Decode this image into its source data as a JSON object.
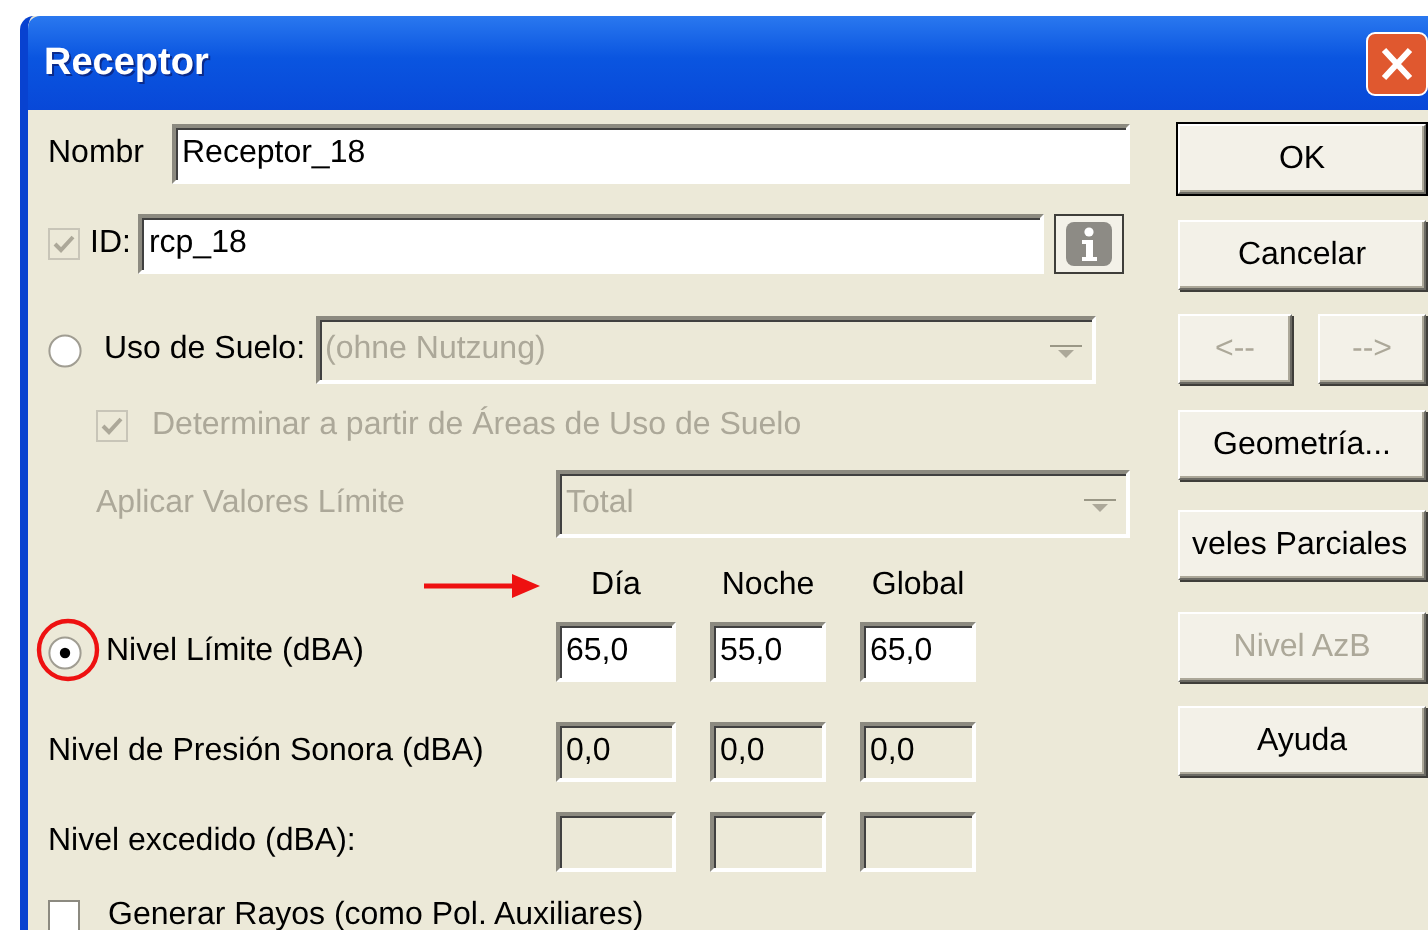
{
  "window": {
    "title": "Receptor"
  },
  "name_field": {
    "label": "Nombr",
    "value": "Receptor_18"
  },
  "id_field": {
    "checked": true,
    "disabled": true,
    "label": "ID:",
    "value": "rcp_18"
  },
  "land_use": {
    "selected": false,
    "label": "Uso de Suelo:",
    "value": "(ohne Nutzung)",
    "disabled": true
  },
  "determine": {
    "checked": true,
    "disabled": true,
    "label": "Determinar a partir de Áreas de Uso de Suelo"
  },
  "apply_limits": {
    "label": "Aplicar Valores Límite",
    "value": "Total",
    "disabled": true
  },
  "header_arrow": true,
  "columns": [
    {
      "label": "Día"
    },
    {
      "label": "Noche"
    },
    {
      "label": "Global"
    }
  ],
  "rows": [
    {
      "kind": "radio",
      "label": "Nivel Límite (dBA)",
      "selected": true,
      "marked": true,
      "cells": [
        {
          "value": "65,0",
          "disabled": false
        },
        {
          "value": "55,0",
          "disabled": false
        },
        {
          "value": "65,0",
          "disabled": false
        }
      ]
    },
    {
      "kind": "plain",
      "label": "Nivel de Presión Sonora (dBA)",
      "cells": [
        {
          "value": "0,0",
          "disabled": true
        },
        {
          "value": "0,0",
          "disabled": true
        },
        {
          "value": "0,0",
          "disabled": true
        }
      ]
    },
    {
      "kind": "plain",
      "label": "Nivel excedido (dBA):",
      "cells": [
        {
          "disabled": true
        },
        {
          "disabled": true
        },
        {
          "disabled": true
        }
      ]
    }
  ],
  "generate_rays": {
    "checked": false,
    "label": "Generar Rayos (como Pol. Auxiliares)"
  },
  "buttons": [
    {
      "kind": "wide",
      "label": "OK",
      "default": true,
      "disabled": false
    },
    {
      "kind": "wide",
      "label": "Cancelar",
      "default": false,
      "disabled": false
    },
    {
      "kind": "pair",
      "items": [
        {
          "label": "<--",
          "disabled": true
        },
        {
          "label": "-->",
          "disabled": true
        }
      ]
    },
    {
      "kind": "wide",
      "label": "Geometría...",
      "default": false,
      "disabled": false
    },
    {
      "kind": "clipped",
      "label": "veles Parciales",
      "default": false,
      "disabled": false
    },
    {
      "kind": "wide",
      "label": "Nivel AzB",
      "default": false,
      "disabled": true
    },
    {
      "kind": "wide",
      "label": "Ayuda",
      "default": false,
      "disabled": false
    }
  ]
}
